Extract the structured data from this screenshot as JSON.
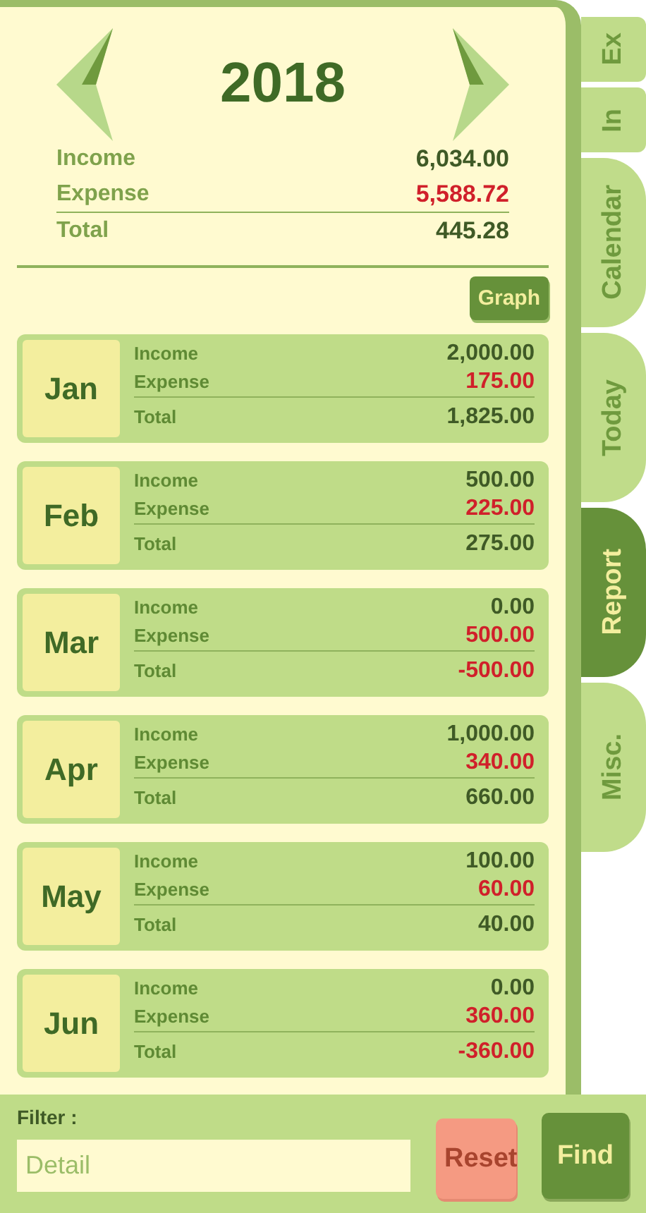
{
  "year": "2018",
  "summary": {
    "income_label": "Income",
    "income": "6,034.00",
    "expense_label": "Expense",
    "expense": "5,588.72",
    "total_label": "Total",
    "total": "445.28",
    "total_negative": false
  },
  "graph_button": "Graph",
  "months": [
    {
      "name": "Jan",
      "income_label": "Income",
      "income": "2,000.00",
      "expense_label": "Expense",
      "expense": "175.00",
      "total_label": "Total",
      "total": "1,825.00",
      "negative": false
    },
    {
      "name": "Feb",
      "income_label": "Income",
      "income": "500.00",
      "expense_label": "Expense",
      "expense": "225.00",
      "total_label": "Total",
      "total": "275.00",
      "negative": false
    },
    {
      "name": "Mar",
      "income_label": "Income",
      "income": "0.00",
      "expense_label": "Expense",
      "expense": "500.00",
      "total_label": "Total",
      "total": "-500.00",
      "negative": true
    },
    {
      "name": "Apr",
      "income_label": "Income",
      "income": "1,000.00",
      "expense_label": "Expense",
      "expense": "340.00",
      "total_label": "Total",
      "total": "660.00",
      "negative": false
    },
    {
      "name": "May",
      "income_label": "Income",
      "income": "100.00",
      "expense_label": "Expense",
      "expense": "60.00",
      "total_label": "Total",
      "total": "40.00",
      "negative": false
    },
    {
      "name": "Jun",
      "income_label": "Income",
      "income": "0.00",
      "expense_label": "Expense",
      "expense": "360.00",
      "total_label": "Total",
      "total": "-360.00",
      "negative": true
    }
  ],
  "tabs": [
    {
      "label": "Ex",
      "kind": "small",
      "selected": false
    },
    {
      "label": "In",
      "kind": "small",
      "selected": false
    },
    {
      "label": "Calendar",
      "kind": "large",
      "selected": false
    },
    {
      "label": "Today",
      "kind": "large",
      "selected": false
    },
    {
      "label": "Report",
      "kind": "large",
      "selected": true
    },
    {
      "label": "Misc.",
      "kind": "large",
      "selected": false
    }
  ],
  "filter": {
    "label": "Filter :",
    "placeholder": "Detail"
  },
  "buttons": [
    {
      "label": "Reset",
      "kind": "reset",
      "disabled": true
    },
    {
      "label": "Find",
      "kind": "find",
      "disabled": false
    }
  ]
}
